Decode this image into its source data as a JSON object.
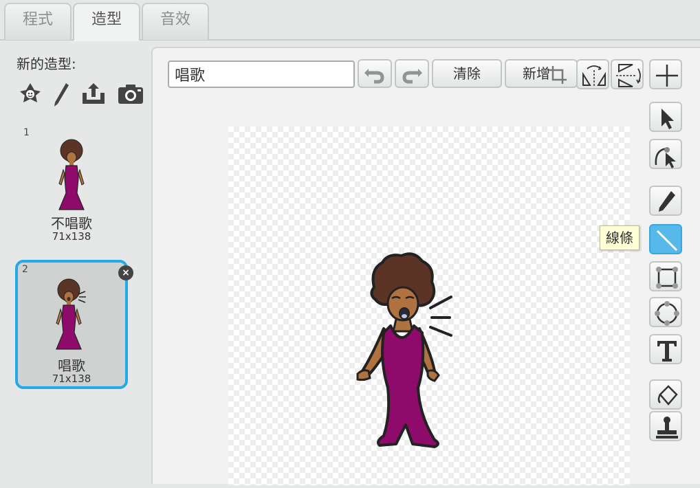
{
  "tabs": [
    {
      "label": "程式",
      "active": false
    },
    {
      "label": "造型",
      "active": true
    },
    {
      "label": "音效",
      "active": false
    }
  ],
  "left_panel": {
    "new_costume_label": "新的造型:",
    "new_costume_icons": [
      "choose-from-library-icon",
      "paint-brush-icon",
      "upload-file-icon",
      "camera-icon"
    ],
    "costumes": [
      {
        "number": "1",
        "name": "不唱歌",
        "size": "71x138",
        "selected": false
      },
      {
        "number": "2",
        "name": "唱歌",
        "size": "71x138",
        "selected": true
      }
    ],
    "delete_icon": "×"
  },
  "editor": {
    "costume_name_value": "唱歌",
    "buttons": {
      "undo_icon": "undo-icon",
      "redo_icon": "redo-icon",
      "clear": "清除",
      "add": "新增"
    },
    "top_tools": [
      "crop-icon",
      "flip-horizontal-icon",
      "flip-vertical-icon",
      "set-center-icon"
    ],
    "tools": [
      "select-icon",
      "reshape-icon",
      "pencil-icon",
      "line-icon",
      "rectangle-icon",
      "ellipse-icon",
      "text-icon",
      "fill-bucket-icon",
      "stamp-icon"
    ],
    "selected_tool": "line-icon",
    "tooltip": "線條",
    "colors": {
      "accent": "#25a9e8",
      "selected_tool": "#57b9ea",
      "dress": "#8e0b6b",
      "hair": "#5b3426",
      "skin": "#b0723f"
    }
  }
}
